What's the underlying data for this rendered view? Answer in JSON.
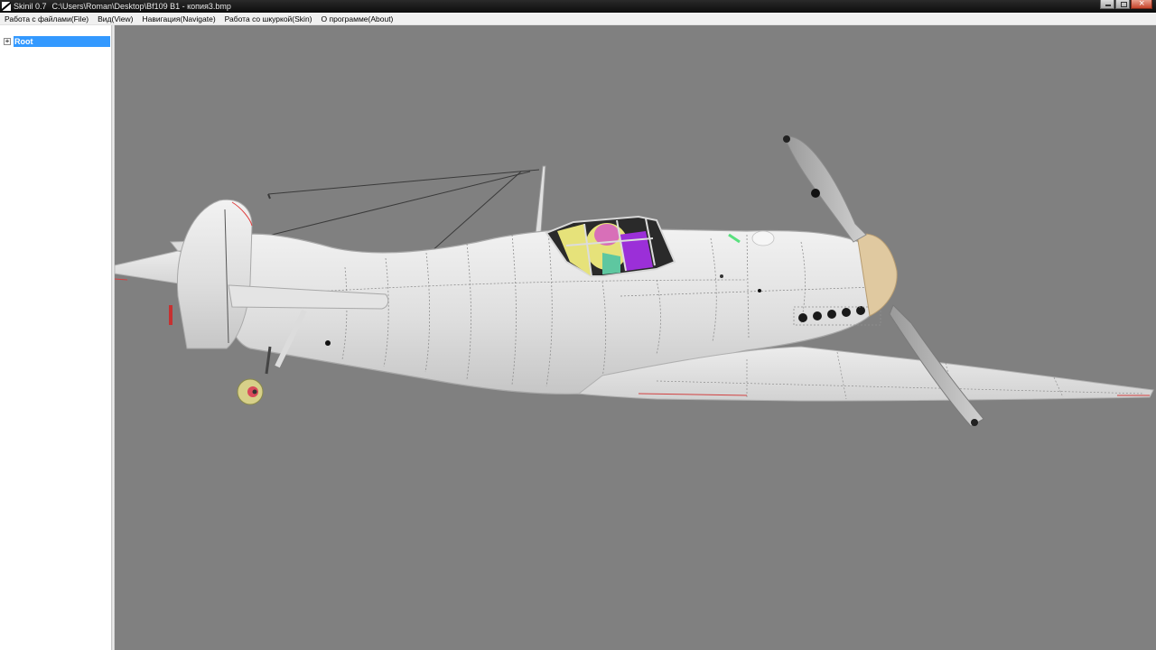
{
  "window": {
    "app_name": "Skinil 0.7",
    "file_path": "C:\\Users\\Roman\\Desktop\\Bf109 B1 - копия3.bmp"
  },
  "menu": {
    "items": [
      "Работа с файлами(File)",
      "Вид(View)",
      "Навигация(Navigate)",
      "Работа со шкуркой(Skin)",
      "О программе(About)"
    ]
  },
  "tree": {
    "expander": "+",
    "root_label": "Root"
  },
  "colors": {
    "viewport_bg": "#808080",
    "selection": "#3399ff",
    "aircraft_skin": "#e6e6e6",
    "canopy_purple": "#9b2fd8",
    "canopy_yellow": "#e6e27a"
  }
}
